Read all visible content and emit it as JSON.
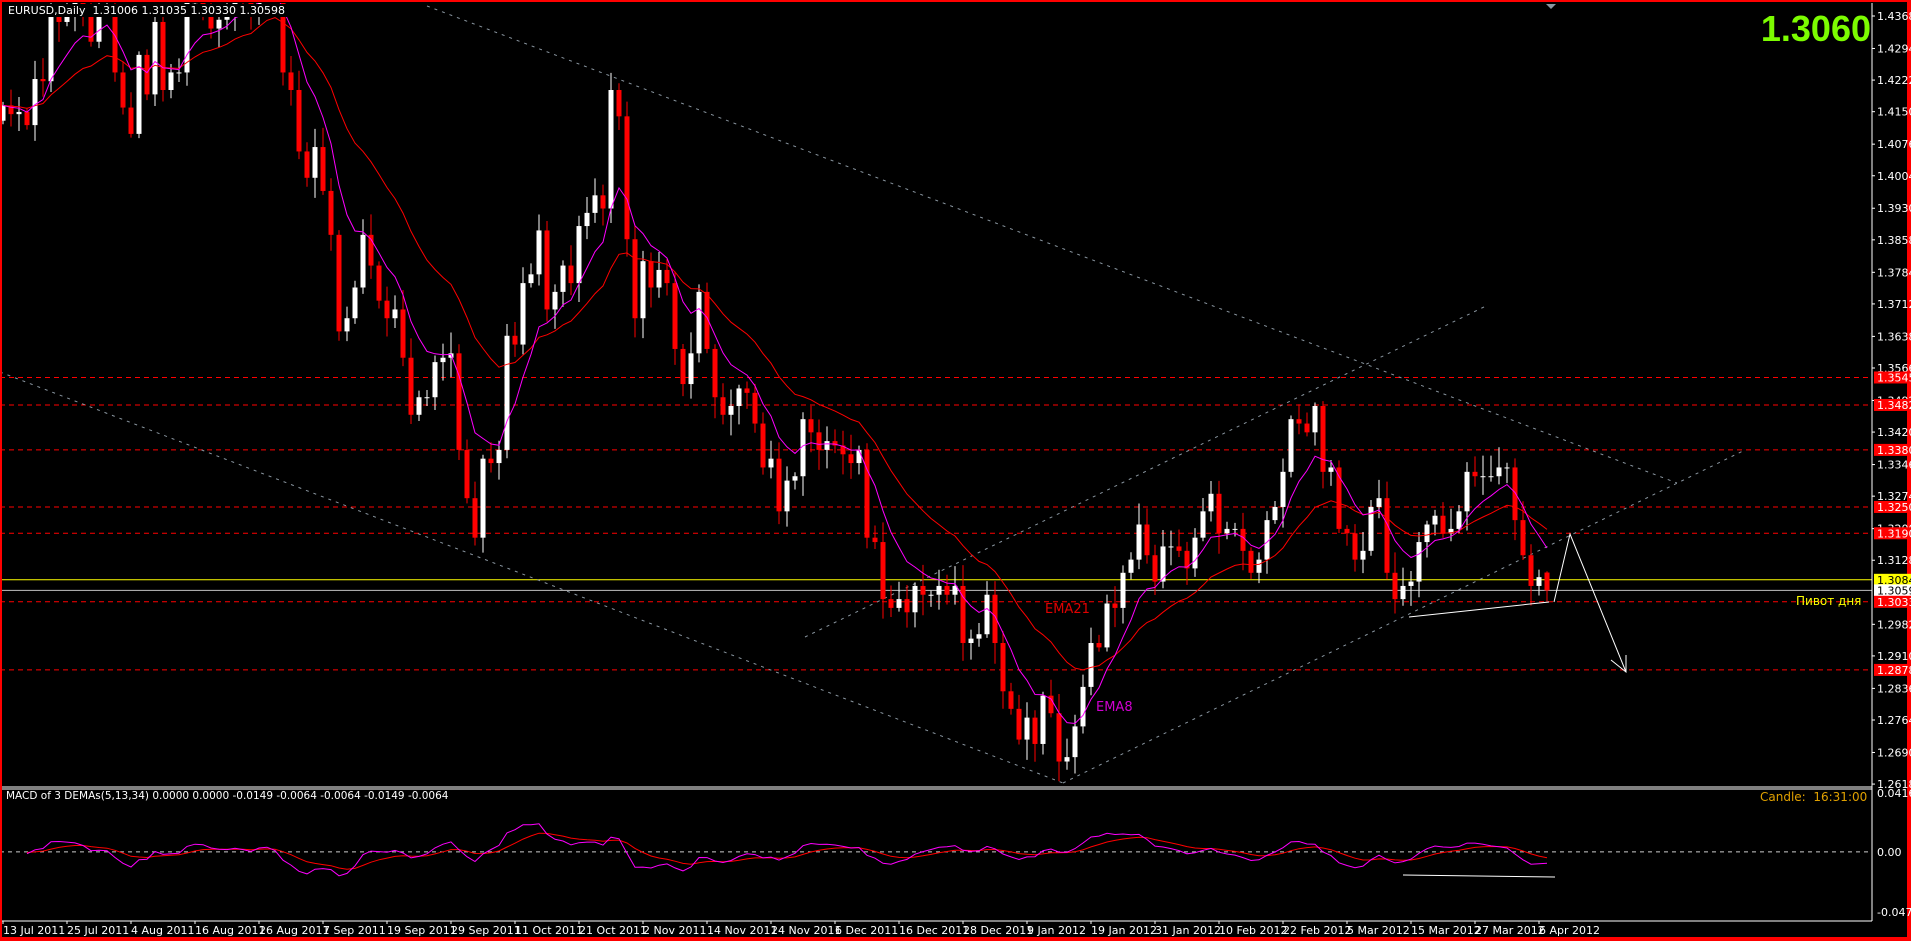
{
  "header": {
    "symbol": "EURUSD,Daily",
    "open": "1.31006",
    "high": "1.31035",
    "low": "1.30330",
    "close": "1.30598"
  },
  "bid_display": "1.3060",
  "pivot_label": "Пивот дня",
  "ema_labels": {
    "ema21": "EMA21",
    "ema8": "EMA8"
  },
  "candle_timer": {
    "label": "Candle:",
    "time": "16:31:00"
  },
  "macd": {
    "header": "MACD of 3 DEMAs(5,13,34) 0.0000 0.0000 -0.0149 -0.0064 -0.0064 -0.0149 -0.0064",
    "axis_labels": [
      "0.0416",
      "0.00",
      "-0.047"
    ],
    "range": [
      -0.047,
      0.0416
    ]
  },
  "colors": {
    "background": "#000000",
    "bull": "#ffffff",
    "bear": "#ff0000",
    "ema8": "#ff00ff",
    "ema21": "#ff0000",
    "level": "#ff0000",
    "pivot": "#ffff00",
    "bid_text": "#7cfc00",
    "trendline": "#8a96a0",
    "timer": "#e0a000"
  },
  "chart_data": {
    "type": "candlestick",
    "symbol": "EURUSD",
    "timeframe": "Daily",
    "price_range": [
      1.26186,
      1.43686
    ],
    "price_axis_labels": [
      "1.43686",
      "1.42946",
      "1.42226",
      "1.41506",
      "1.40766",
      "1.40046",
      "1.39306",
      "1.38586",
      "1.37846",
      "1.37126",
      "1.36386",
      "1.35666",
      "1.34926",
      "1.34206",
      "1.33466",
      "1.32746",
      "1.32006",
      "1.31286",
      "1.29826",
      "1.29106",
      "1.28366",
      "1.27646",
      "1.26906",
      "1.26186"
    ],
    "date_labels": [
      "13 Jul 2011",
      "25 Jul 2011",
      "4 Aug 2011",
      "16 Aug 2011",
      "26 Aug 2011",
      "7 Sep 2011",
      "19 Sep 2011",
      "29 Sep 2011",
      "11 Oct 2011",
      "21 Oct 2011",
      "2 Nov 2011",
      "14 Nov 2011",
      "24 Nov 2011",
      "6 Dec 2011",
      "16 Dec 2011",
      "28 Dec 2011",
      "9 Jan 2012",
      "19 Jan 2012",
      "31 Jan 2012",
      "10 Feb 2012",
      "22 Feb 2012",
      "5 Mar 2012",
      "15 Mar 2012",
      "27 Mar 2012",
      "6 Apr 2012"
    ],
    "first_open": 1.413,
    "closes": [
      1.4165,
      1.4145,
      1.415,
      1.412,
      1.4225,
      1.422,
      1.4385,
      1.4355,
      1.4375,
      1.44,
      1.438,
      1.431,
      1.439,
      1.439,
      1.424,
      1.416,
      1.41,
      1.428,
      1.419,
      1.4355,
      1.42,
      1.424,
      1.424,
      1.44,
      1.44,
      1.439,
      1.434,
      1.436,
      1.438,
      1.443,
      1.44,
      1.438,
      1.45,
      1.45,
      1.443,
      1.424,
      1.42,
      1.406,
      1.4,
      1.407,
      1.397,
      1.387,
      1.365,
      1.368,
      1.375,
      1.387,
      1.38,
      1.372,
      1.368,
      1.37,
      1.359,
      1.346,
      1.35,
      1.35,
      1.358,
      1.359,
      1.36,
      1.338,
      1.327,
      1.318,
      1.336,
      1.335,
      1.338,
      1.364,
      1.362,
      1.376,
      1.378,
      1.388,
      1.37,
      1.374,
      1.38,
      1.376,
      1.389,
      1.392,
      1.396,
      1.393,
      1.42,
      1.414,
      1.386,
      1.368,
      1.381,
      1.375,
      1.379,
      1.376,
      1.361,
      1.353,
      1.36,
      1.374,
      1.361,
      1.35,
      1.346,
      1.348,
      1.352,
      1.351,
      1.344,
      1.334,
      1.336,
      1.324,
      1.331,
      1.332,
      1.345,
      1.342,
      1.338,
      1.34,
      1.339,
      1.337,
      1.335,
      1.338,
      1.318,
      1.317,
      1.304,
      1.302,
      1.304,
      1.301,
      1.307,
      1.305,
      1.305,
      1.307,
      1.305,
      1.307,
      1.294,
      1.295,
      1.296,
      1.305,
      1.294,
      1.283,
      1.279,
      1.272,
      1.277,
      1.271,
      1.282,
      1.278,
      1.267,
      1.268,
      1.275,
      1.284,
      1.294,
      1.293,
      1.303,
      1.302,
      1.31,
      1.313,
      1.321,
      1.314,
      1.308,
      1.316,
      1.316,
      1.315,
      1.311,
      1.318,
      1.324,
      1.328,
      1.319,
      1.32,
      1.32,
      1.315,
      1.31,
      1.313,
      1.322,
      1.325,
      1.333,
      1.345,
      1.344,
      1.342,
      1.348,
      1.333,
      1.334,
      1.32,
      1.319,
      1.313,
      1.315,
      1.325,
      1.327,
      1.31,
      1.304,
      1.307,
      1.308,
      1.317,
      1.321,
      1.323,
      1.319,
      1.32,
      1.324,
      1.333,
      1.332,
      1.332,
      1.332,
      1.334,
      1.334,
      1.322,
      1.314,
      1.307,
      1.309,
      1.30598
    ],
    "indicators": [
      "EMA8",
      "EMA21"
    ],
    "levels": [
      {
        "price": "1.35450",
        "style": "dashed",
        "color": "#ff0000"
      },
      {
        "price": "1.34824",
        "style": "dashed",
        "color": "#ff0000"
      },
      {
        "price": "1.33800",
        "style": "dashed",
        "color": "#ff0000"
      },
      {
        "price": "1.32500",
        "style": "dashed",
        "color": "#ff0000"
      },
      {
        "price": "1.31900",
        "style": "dashed",
        "color": "#ff0000"
      },
      {
        "price": "1.30840",
        "style": "solid",
        "color": "#ffff00"
      },
      {
        "price": "1.30598",
        "style": "solid",
        "color": "#c0c0c0"
      },
      {
        "price": "1.30339",
        "style": "dashed",
        "color": "#ff0000"
      },
      {
        "price": "1.28787",
        "style": "dashed",
        "color": "#ff0000"
      }
    ]
  }
}
